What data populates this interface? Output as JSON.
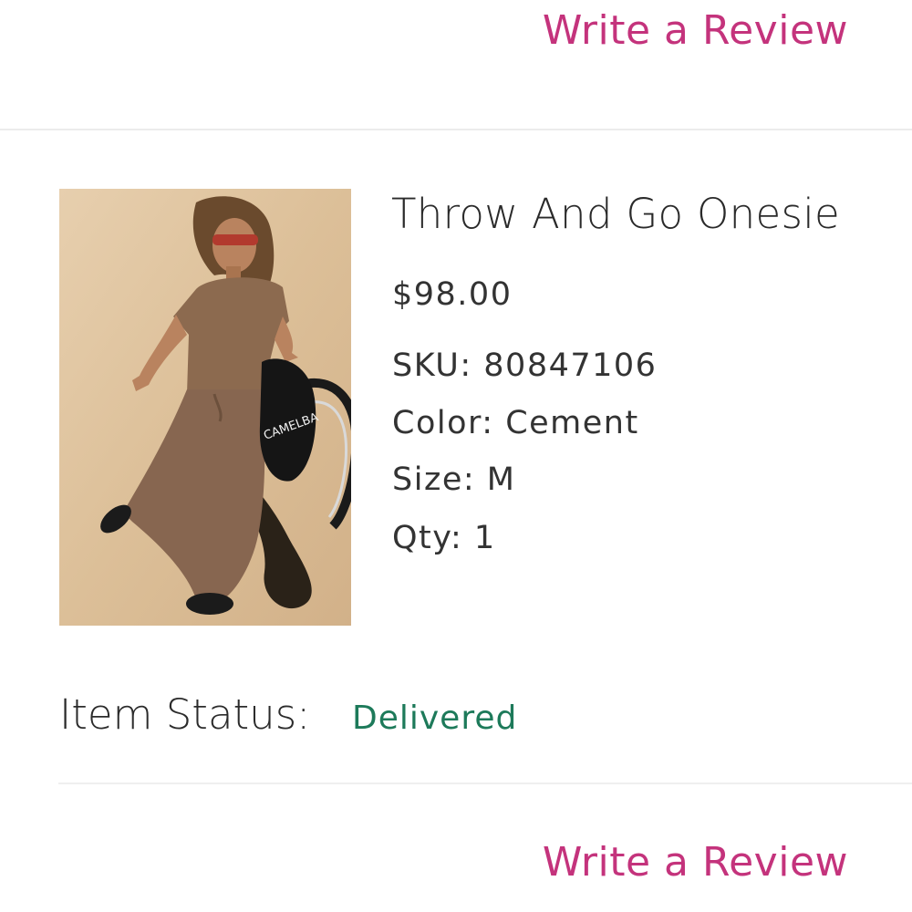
{
  "actions": {
    "write_review_top": "Write a Review",
    "write_review_bottom": "Write a Review"
  },
  "product": {
    "name": "Throw And Go Onesie",
    "price": "$98.00",
    "sku_label": "SKU:",
    "sku": "80847106",
    "color_label": "Color:",
    "color": "Cement",
    "size_label": "Size:",
    "size": "M",
    "qty_label": "Qty:",
    "qty": "1",
    "image_brand_text": "CAMELBA"
  },
  "status": {
    "label": "Item Status:",
    "value": "Delivered",
    "value_color": "#1d7a5a"
  },
  "colors": {
    "accent_link": "#c4337c",
    "text": "#2a2a2a"
  }
}
